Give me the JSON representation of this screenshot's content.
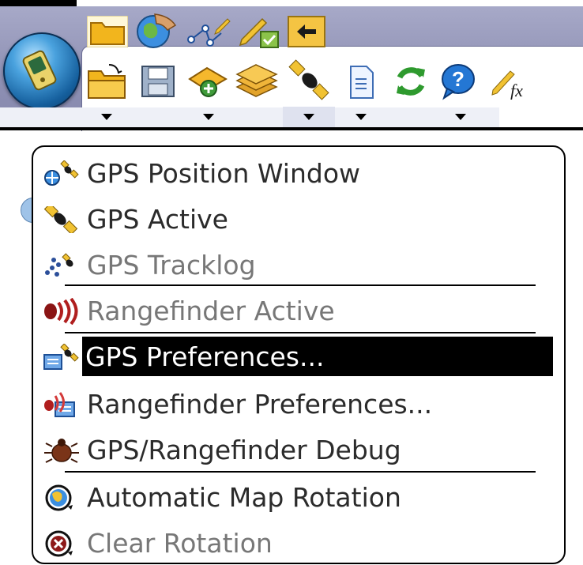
{
  "app": {
    "orb_icon": "gps-device-icon"
  },
  "toolbar": {
    "tabs": [
      {
        "name": "folder-tab-icon"
      },
      {
        "name": "globe-hand-tab-icon"
      },
      {
        "name": "network-tab-icon"
      },
      {
        "name": "edit-check-tab-icon"
      },
      {
        "name": "back-arrow-tab-icon"
      }
    ],
    "tools": [
      {
        "name": "open-folder-icon"
      },
      {
        "name": "save-disk-icon"
      },
      {
        "name": "add-point-icon"
      },
      {
        "name": "layers-icon"
      },
      {
        "name": "gps-satellite-icon"
      },
      {
        "name": "document-icon"
      },
      {
        "name": "refresh-icon"
      },
      {
        "name": "help-icon"
      },
      {
        "name": "formula-edit-icon"
      }
    ]
  },
  "menu": {
    "items": [
      {
        "label": "GPS Position Window",
        "icon": "gps-position-icon",
        "state": "enabled"
      },
      {
        "label": "GPS Active",
        "icon": "satellite-icon",
        "state": "enabled"
      },
      {
        "label": "GPS Tracklog",
        "icon": "tracklog-icon",
        "state": "disabled"
      },
      {
        "label": "Rangefinder Active",
        "icon": "rangefinder-icon",
        "state": "disabled"
      },
      {
        "label": "GPS Preferences...",
        "icon": "gps-preferences-icon",
        "state": "selected"
      },
      {
        "label": "Rangefinder Preferences...",
        "icon": "rangefinder-preferences-icon",
        "state": "enabled"
      },
      {
        "label": "GPS/Rangefinder Debug",
        "icon": "debug-bug-icon",
        "state": "enabled"
      },
      {
        "label": "Automatic Map Rotation",
        "icon": "auto-rotation-icon",
        "state": "enabled"
      },
      {
        "label": "Clear Rotation",
        "icon": "clear-rotation-icon",
        "state": "disabled"
      }
    ]
  },
  "colors": {
    "toolbar_bg": "#8f91b4",
    "selection_bg": "#000000",
    "disabled_text": "#777777",
    "text": "#2b2b2b"
  }
}
